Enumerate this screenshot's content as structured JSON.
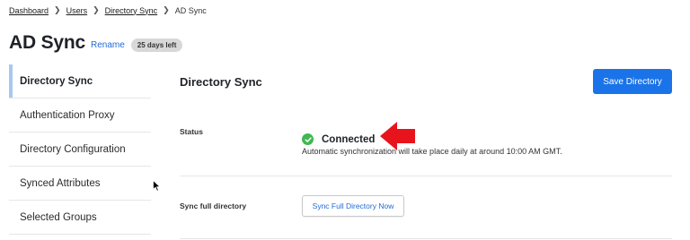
{
  "breadcrumb": {
    "items": [
      {
        "label": "Dashboard",
        "link": true
      },
      {
        "label": "Users",
        "link": true
      },
      {
        "label": "Directory Sync",
        "link": true
      },
      {
        "label": "AD Sync",
        "link": false
      }
    ],
    "separator": ">"
  },
  "header": {
    "title": "AD Sync",
    "rename_label": "Rename",
    "badge": "25 days left"
  },
  "sidebar": {
    "items": [
      {
        "label": "Directory Sync",
        "active": true
      },
      {
        "label": "Authentication Proxy",
        "active": false
      },
      {
        "label": "Directory Configuration",
        "active": false
      },
      {
        "label": "Synced Attributes",
        "active": false
      },
      {
        "label": "Selected Groups",
        "active": false
      }
    ]
  },
  "main": {
    "section_title": "Directory Sync",
    "save_label": "Save Directory",
    "status": {
      "label": "Status",
      "value": "Connected",
      "description": "Automatic synchronization will take place daily at around 10:00 AM GMT."
    },
    "sync": {
      "label": "Sync full directory",
      "button_label": "Sync Full Directory Now"
    }
  },
  "colors": {
    "accent": "#1a73e8",
    "link": "#1f6ad4",
    "success": "#3fb950",
    "annotation_arrow": "#e8141c",
    "sidebar_indicator": "#a9c8ef"
  },
  "icons": {
    "status": "check-circle-icon",
    "annotation": "red-arrow-icon",
    "cursor": "mouse-cursor-icon"
  }
}
